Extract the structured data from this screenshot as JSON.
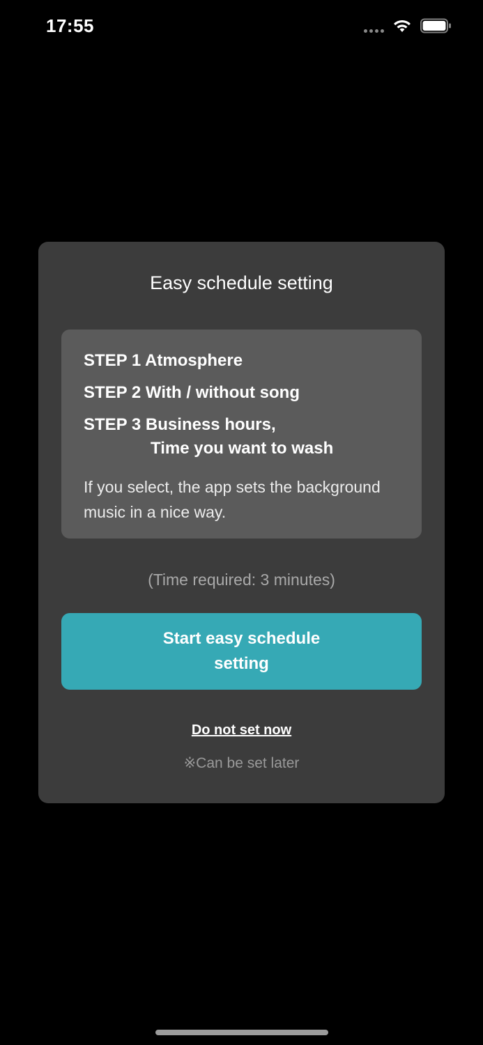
{
  "status_bar": {
    "time": "17:55",
    "icons": [
      "signal-dots-icon",
      "wifi-icon",
      "battery-icon"
    ]
  },
  "modal": {
    "title": "Easy schedule setting",
    "steps": [
      {
        "label": "STEP 1 Atmosphere"
      },
      {
        "label": "STEP 2 With / without song"
      },
      {
        "label": "STEP 3 Business hours,",
        "continuation": "Time you want to wash"
      }
    ],
    "note": "If you select, the app sets the background music in a nice way.",
    "time_required": "(Time required: 3 minutes)",
    "start_button_label": "Start easy schedule setting",
    "skip_label": "Do not set now",
    "later_note": "※Can be set later"
  },
  "colors": {
    "background": "#000000",
    "modal": "#3c3c3c",
    "steps_box": "#5b5b5b",
    "accent": "#36a9b5"
  }
}
